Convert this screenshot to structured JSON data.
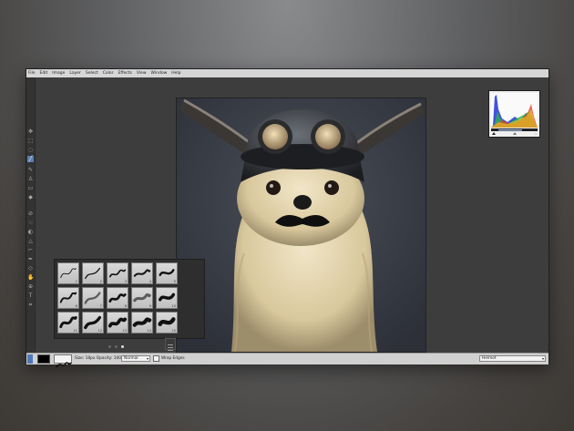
{
  "menu": [
    "File",
    "Edit",
    "Image",
    "Layer",
    "Select",
    "Color",
    "Effects",
    "View",
    "Window",
    "Help"
  ],
  "tools": [
    "move-icon",
    "marquee-icon",
    "lasso-icon",
    "gradient-icon",
    "brush-icon",
    "clone-icon",
    "eraser-icon",
    "fill-icon",
    "picker-icon",
    "text-icon",
    "shape-icon",
    "zoom-icon"
  ],
  "brushes": [
    {
      "n": "1"
    },
    {
      "n": "2"
    },
    {
      "n": "3"
    },
    {
      "n": "4"
    },
    {
      "n": "5"
    },
    {
      "n": "6"
    },
    {
      "n": "7"
    },
    {
      "n": "8"
    },
    {
      "n": "9"
    },
    {
      "n": "10"
    },
    {
      "n": "11"
    },
    {
      "n": "12"
    },
    {
      "n": "13"
    },
    {
      "n": "14"
    },
    {
      "n": "15"
    }
  ],
  "status": {
    "brush_info": "Size: 18px  Opacity: 100%",
    "blend_mode": "Normal",
    "wrap_label": "Wrap Edges",
    "preset": "Helmet"
  },
  "colors": {
    "primary": "#000000",
    "accent": "#5b7fb0"
  }
}
